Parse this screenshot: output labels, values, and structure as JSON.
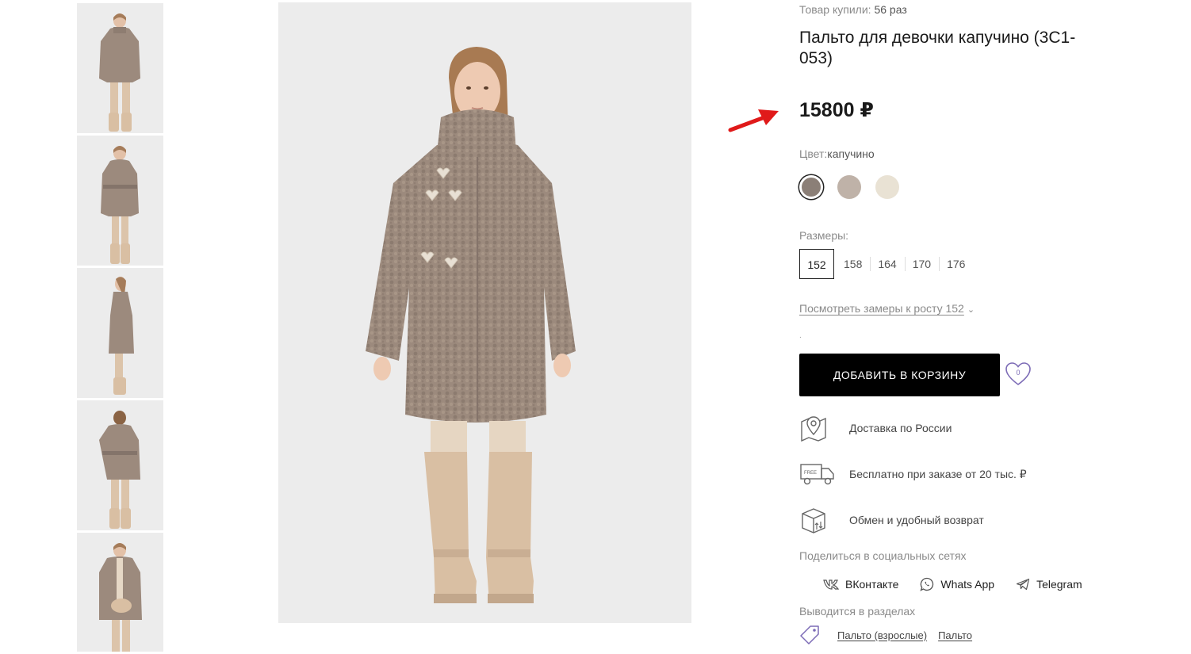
{
  "product": {
    "bought_label": "Товар купили:",
    "bought_count": "56 раз",
    "title": "Пальто для девочки капучино (3С1-053)",
    "price": "15800 ₽"
  },
  "color": {
    "label": "Цвет:",
    "value": "капучино",
    "swatches": [
      "#8b7f77",
      "#bfb2a8",
      "#e9e2d4"
    ]
  },
  "sizes": {
    "label": "Размеры:",
    "items": [
      "152",
      "158",
      "164",
      "170",
      "176"
    ],
    "selected": "152"
  },
  "measure_link": "Посмотреть замеры к росту 152",
  "dot": ".",
  "add_to_cart": "ДОБАВИТЬ В КОРЗИНУ",
  "wishlist_count": "0",
  "features": [
    {
      "icon": "map-pin-icon",
      "text": "Доставка по России"
    },
    {
      "icon": "delivery-truck-icon",
      "text": "Бесплатно при заказе от 20 тыс. ₽"
    },
    {
      "icon": "return-box-icon",
      "text": "Обмен и удобный возврат"
    }
  ],
  "share": {
    "label": "Поделиться в социальных сетях",
    "items": [
      {
        "icon": "vk-icon",
        "label": "ВКонтакте"
      },
      {
        "icon": "whatsapp-icon",
        "label": "Whats App"
      },
      {
        "icon": "telegram-icon",
        "label": "Telegram"
      }
    ]
  },
  "sections": {
    "label": "Выводится в разделах",
    "links": [
      "Пальто (взрослые)",
      "Пальто"
    ]
  },
  "colors": {
    "coat": "#9c8a7d",
    "boots": "#d9bfa3",
    "accent_arrow": "#e01a1a",
    "wishlist": "#7c6bb6"
  }
}
